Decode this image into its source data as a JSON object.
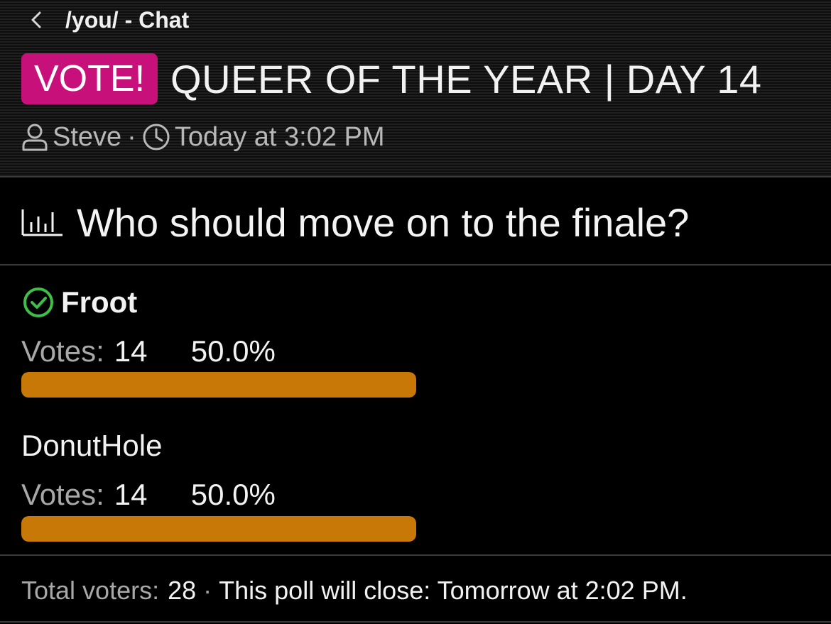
{
  "nav": {
    "back_label": "/you/ - Chat"
  },
  "thread": {
    "prefix": "VOTE!",
    "prefix_color": "#c8107a",
    "title": "QUEER OF THE YEAR | DAY 14",
    "author": "Steve",
    "separator": "·",
    "timestamp": "Today at 3:02 PM"
  },
  "poll": {
    "question": "Who should move on to the finale?",
    "votes_label": "Votes:",
    "bar_color": "#c87806",
    "options": [
      {
        "name": "Froot",
        "voted": true,
        "votes": "14",
        "percent": "50.0%",
        "fraction": 1.0
      },
      {
        "name": "DonutHole",
        "voted": false,
        "votes": "14",
        "percent": "50.0%",
        "fraction": 1.0
      }
    ],
    "footer": {
      "total_label": "Total voters:",
      "total_value": "28",
      "separator": "·",
      "close_text": "This poll will close: Tomorrow at 2:02 PM."
    }
  },
  "icons": {
    "back": "chevron-left-icon",
    "user": "user-icon",
    "clock": "clock-icon",
    "chart": "bar-chart-icon",
    "check": "check-circle-icon",
    "check_color": "#3fbe4a"
  }
}
